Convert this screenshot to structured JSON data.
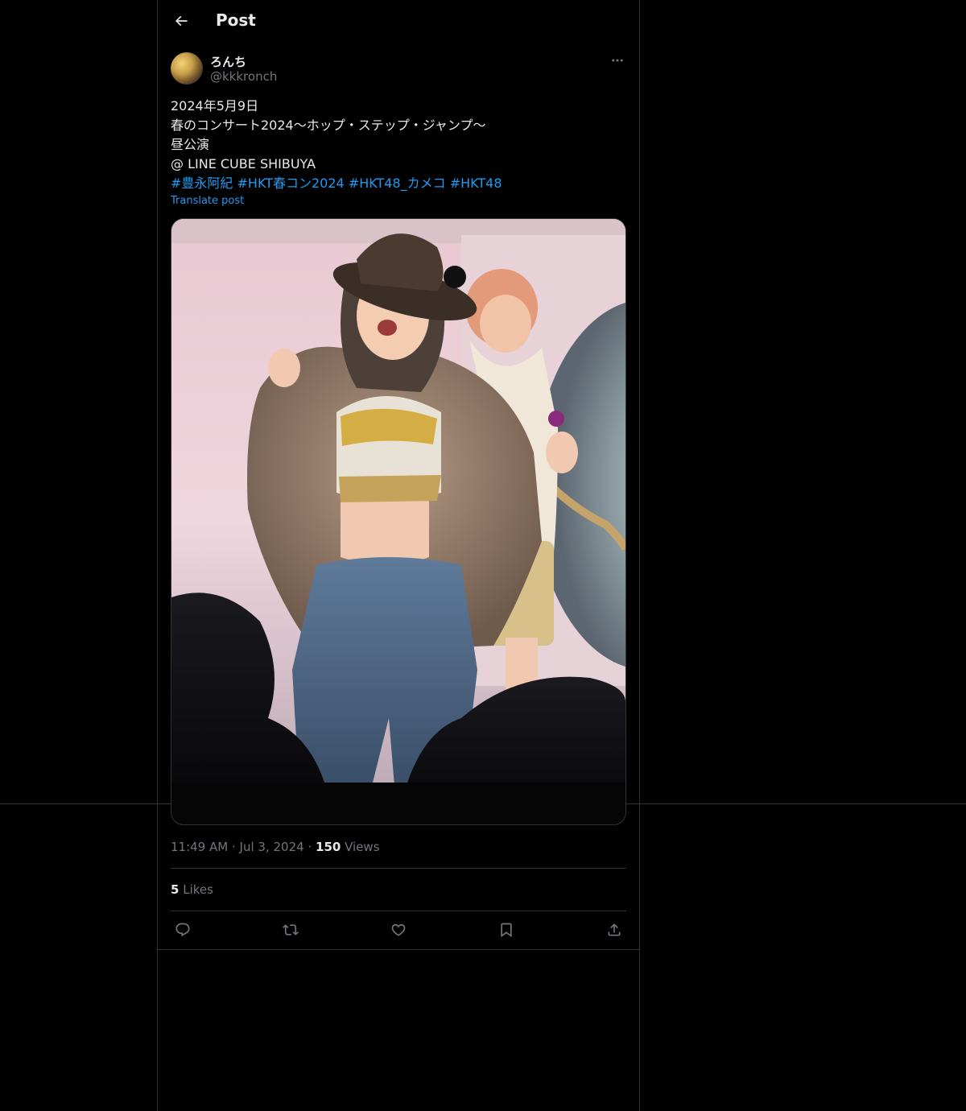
{
  "header": {
    "title": "Post",
    "back_icon": "arrow-left-icon"
  },
  "author": {
    "display_name": "ろんち",
    "handle": "@kkkronch",
    "more_icon": "ellipsis-icon"
  },
  "post": {
    "lines": [
      "2024年5月9日",
      "春のコンサート2024〜ホップ・ステップ・ジャンプ〜",
      "昼公演",
      "@ LINE CUBE SHIBUYA"
    ],
    "hashtags": [
      "#豊永阿紀",
      "#HKT春コン2024",
      "#HKT48_カメコ",
      "#HKT48"
    ],
    "translate_label": "Translate post"
  },
  "meta": {
    "time": "11:49 AM",
    "separator": "·",
    "date": "Jul 3, 2024",
    "views_count": "150",
    "views_label": "Views"
  },
  "stats": {
    "likes_count": "5",
    "likes_label": "Likes"
  },
  "actions": [
    {
      "name": "reply",
      "icon": "reply-icon"
    },
    {
      "name": "repost",
      "icon": "repost-icon"
    },
    {
      "name": "like",
      "icon": "heart-icon"
    },
    {
      "name": "bookmark",
      "icon": "bookmark-icon"
    },
    {
      "name": "share",
      "icon": "share-icon"
    }
  ],
  "colors": {
    "background": "#000000",
    "text": "#e7e9ea",
    "secondary": "#71767b",
    "accent": "#1d9bf0",
    "border": "#2f3336"
  }
}
